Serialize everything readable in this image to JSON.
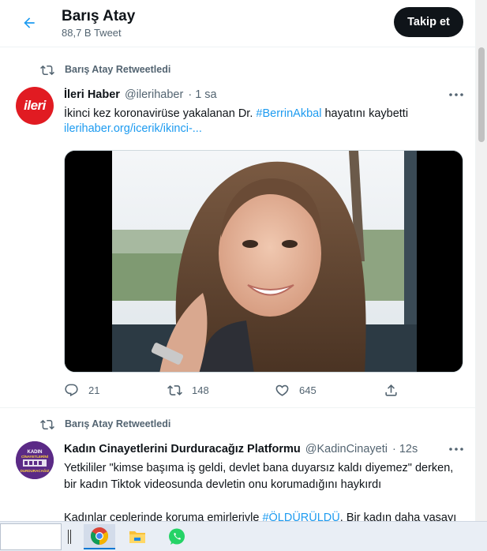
{
  "header": {
    "name": "Barış Atay",
    "subtitle": "88,7 B Tweet",
    "follow_label": "Takip et"
  },
  "tweets": [
    {
      "retweet_label": "Barış Atay Retweetledi",
      "avatar_text": "ileri",
      "name": "İleri Haber",
      "handle": "@ilerihaber",
      "time": "· 1 sa",
      "text_before": "İkinci kez koronavirüse yakalanan Dr. ",
      "hashtag": "#BerrinAkbal",
      "text_after": " hayatını kaybetti",
      "link": "ilerihaber.org/icerik/ikinci-...",
      "replies": "21",
      "retweets": "148",
      "likes": "645"
    },
    {
      "retweet_label": "Barış Atay Retweetledi",
      "avatar_text": "KADIN CİNAYETLERİNİ DURDURACAĞIZ",
      "name": "Kadın Cinayetlerini Durduracağız Platformu",
      "handle": "@KadinCinayeti",
      "time": "· 12s",
      "paragraph1": "Yetkililer \"kimse başıma iş geldi, devlet bana duyarsız kaldı diyemez\" derken, bir kadın Tiktok videosunda devletin onu korumadığını haykırdı",
      "p2_before": "Kadınlar ceplerinde koruma emirleriyle ",
      "p2_hashtag": "#ÖLDÜRÜLDÜ",
      "p2_after": ". Bir kadın daha yaşayı"
    }
  ],
  "icons": {
    "back": "arrow-left-icon",
    "more": "more-horizontal-icon",
    "retweet": "retweet-icon",
    "reply": "reply-icon",
    "like": "heart-icon",
    "share": "share-icon"
  },
  "taskbar": {
    "apps": [
      "chrome-icon",
      "file-explorer-icon",
      "whatsapp-icon"
    ]
  },
  "colors": {
    "accent": "#1d9bf0",
    "text": "#0f1419",
    "muted": "#536471",
    "button": "#0f1419"
  }
}
